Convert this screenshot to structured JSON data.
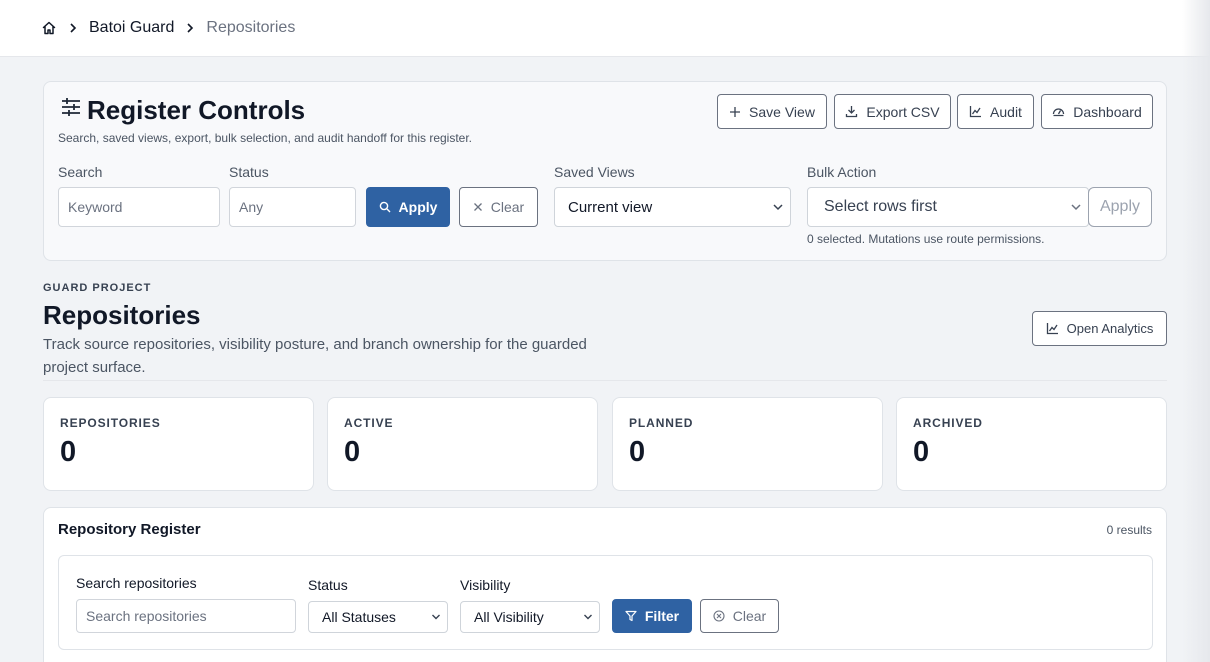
{
  "breadcrumb": {
    "home_icon": "home-icon",
    "items": [
      "Batoi Guard",
      "Repositories"
    ]
  },
  "controls": {
    "title": "Register Controls",
    "subtitle": "Search, saved views, export, bulk selection, and audit handoff for this register.",
    "actions": {
      "save_view": "Save View",
      "export_csv": "Export CSV",
      "audit": "Audit",
      "dashboard": "Dashboard"
    },
    "search_label": "Search",
    "search_placeholder": "Keyword",
    "status_label": "Status",
    "status_placeholder": "Any",
    "apply": "Apply",
    "clear": "Clear",
    "saved_views_label": "Saved Views",
    "saved_views_value": "Current view",
    "bulk_label": "Bulk Action",
    "bulk_value": "Select rows first",
    "bulk_apply": "Apply",
    "bulk_note": "0 selected. Mutations use route permissions."
  },
  "header": {
    "eyebrow": "GUARD PROJECT",
    "title": "Repositories",
    "description": "Track source repositories, visibility posture, and branch ownership for the guarded project surface.",
    "open_analytics": "Open Analytics"
  },
  "stats": [
    {
      "label": "REPOSITORIES",
      "value": "0"
    },
    {
      "label": "ACTIVE",
      "value": "0"
    },
    {
      "label": "PLANNED",
      "value": "0"
    },
    {
      "label": "ARCHIVED",
      "value": "0"
    }
  ],
  "register": {
    "title": "Repository Register",
    "results": "0 results",
    "search_label": "Search repositories",
    "search_placeholder": "Search repositories",
    "status_label": "Status",
    "status_value": "All Statuses",
    "visibility_label": "Visibility",
    "visibility_value": "All Visibility",
    "filter": "Filter",
    "clear": "Clear"
  },
  "colors": {
    "primary": "#2f62a3",
    "background": "#f1f3f6",
    "border": "#dfe3e8"
  }
}
